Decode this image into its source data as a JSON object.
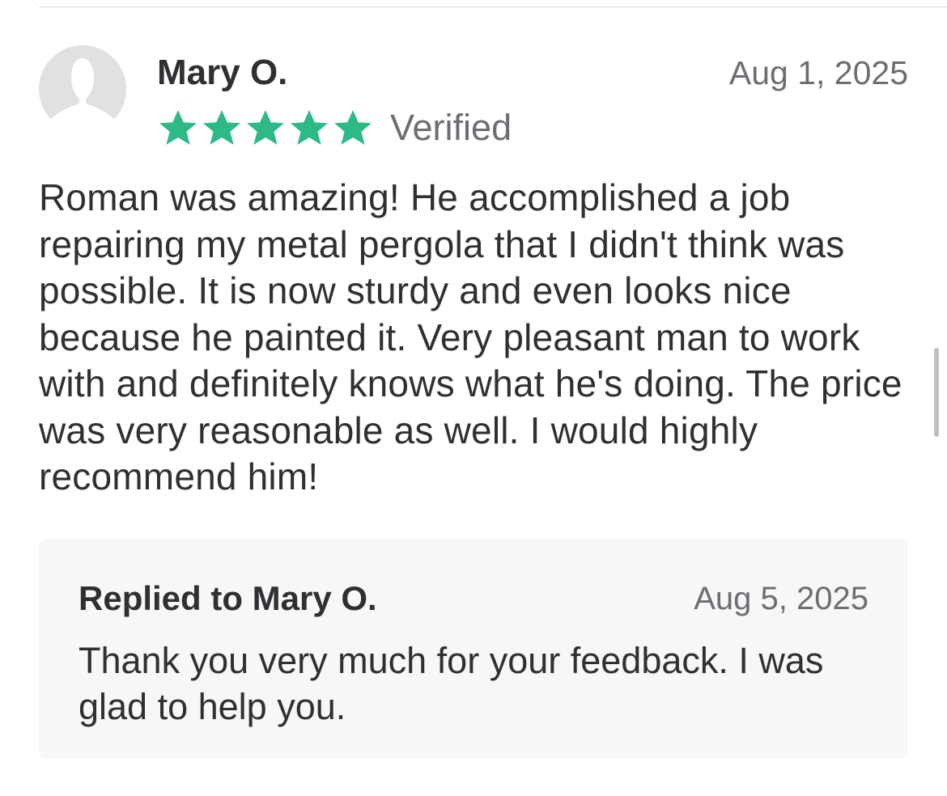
{
  "review": {
    "reviewer_name": "Mary O.",
    "date": "Aug 1, 2025",
    "rating": 5,
    "rating_max": 5,
    "verified_label": "Verified",
    "body": "Roman was amazing! He accomplished a job repairing my metal pergola that I didn't think was possible. It is now sturdy and even looks nice because he painted it. Very pleasant man to work with and definitely knows what he's doing. The price was very reasonable as well. I would highly recommend him!",
    "avatar_icon": "default-user-avatar-icon",
    "star_icon": "star-icon",
    "star_color": "#2dba86"
  },
  "reply": {
    "title": "Replied to Mary O.",
    "date": "Aug 5, 2025",
    "body": "Thank you very much for your feedback. I was glad to help you."
  },
  "colors": {
    "text_primary": "#2f3033",
    "text_secondary": "#6b6e72",
    "reply_background": "#f7f7f7",
    "avatar_background": "#e1e1e1"
  }
}
